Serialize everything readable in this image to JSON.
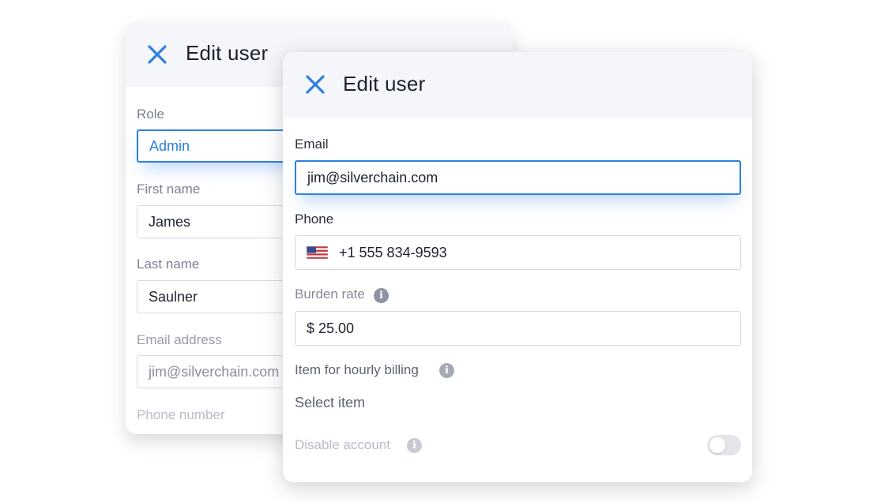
{
  "back_card": {
    "title": "Edit user",
    "close_icon": "close-icon",
    "role": {
      "label": "Role",
      "value": "Admin"
    },
    "first_name": {
      "label": "First name",
      "value": "James"
    },
    "last_name": {
      "label": "Last name",
      "value": "Saulner"
    },
    "email": {
      "label": "Email address",
      "value": "jim@silverchain.com"
    },
    "phone": {
      "label": "Phone number"
    }
  },
  "front_card": {
    "title": "Edit user",
    "close_icon": "close-icon",
    "email": {
      "label": "Email",
      "value": "jim@silverchain.com"
    },
    "phone": {
      "label": "Phone",
      "value": "+1 555 834-9593",
      "flag_icon": "us-flag-icon"
    },
    "burden_rate": {
      "label": "Burden rate",
      "value": "$ 25.00",
      "info_icon": "info-icon"
    },
    "hourly_item": {
      "label": "Item for hourly billing",
      "placeholder": "Select item",
      "info_icon": "info-icon"
    },
    "disable_account": {
      "label": "Disable account",
      "info_icon": "info-icon",
      "enabled": false
    }
  },
  "colors": {
    "accent": "#2c7fe0",
    "header_bg": "#f5f6fa",
    "title_text": "#1d2230",
    "muted_label": "#7b8090"
  }
}
